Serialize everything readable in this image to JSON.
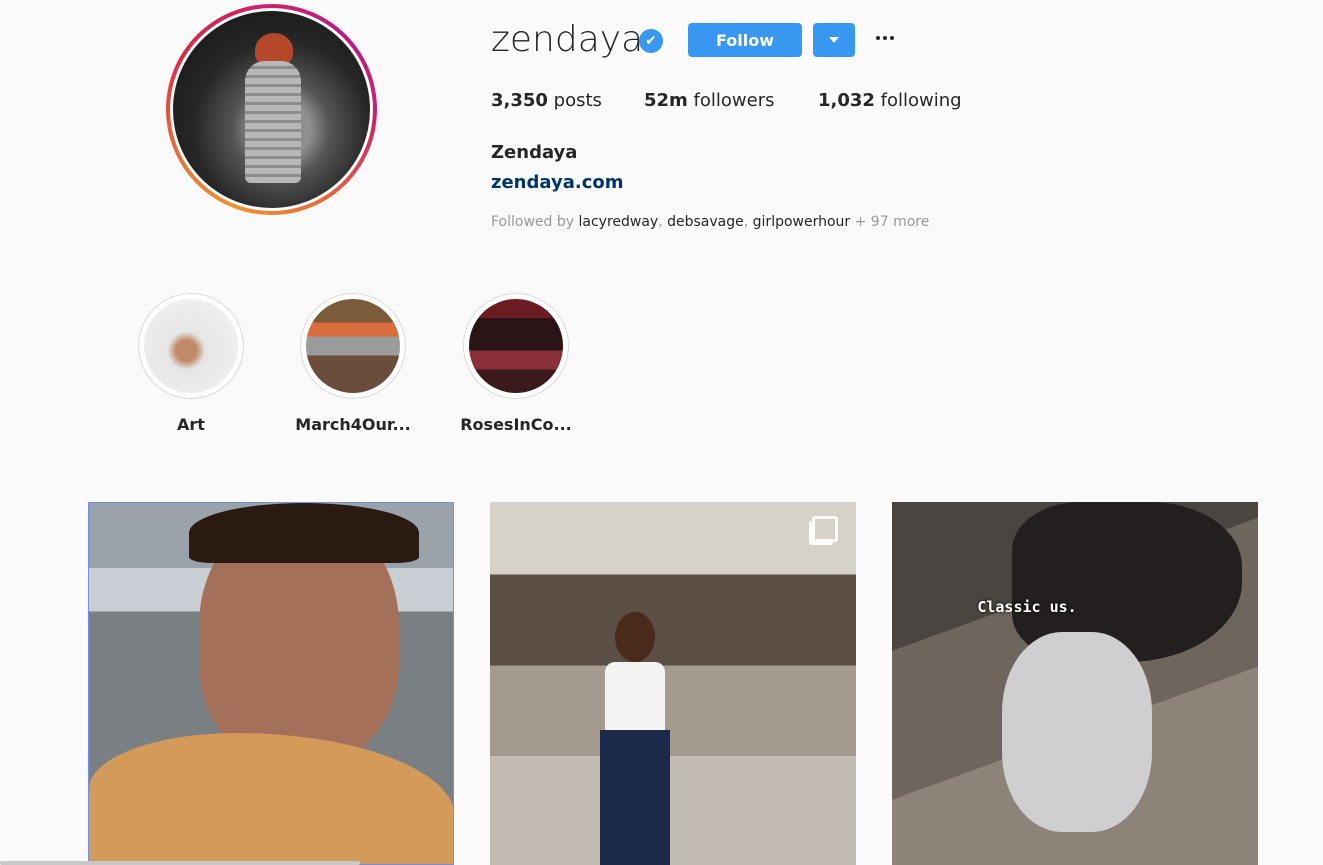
{
  "profile": {
    "username": "zendaya",
    "verified_glyph": "✔",
    "follow_label": "Follow",
    "more_icon": "more-horizontal-icon",
    "dropdown_icon": "chevron-down-icon",
    "stats": {
      "posts_count": "3,350",
      "posts_label": " posts",
      "followers_count": "52m",
      "followers_label": " followers",
      "following_count": "1,032",
      "following_label": " following"
    },
    "full_name": "Zendaya",
    "website": "zendaya.com",
    "followed_by": {
      "prefix": "Followed by ",
      "users": [
        "lacyredway",
        "debsavage",
        "girlpowerhour"
      ],
      "suffix": " + 97 more"
    }
  },
  "highlights": [
    {
      "label": "Art"
    },
    {
      "label": "March4Our..."
    },
    {
      "label": "RosesInCo..."
    }
  ],
  "posts": [
    {
      "type": "photo"
    },
    {
      "type": "carousel",
      "icon": "multiple-posts-icon"
    },
    {
      "type": "photo",
      "overlay_text": "Classic us."
    }
  ],
  "colors": {
    "accent": "#3897f0",
    "link": "#003569",
    "muted": "#999999",
    "background": "#fafafa"
  }
}
